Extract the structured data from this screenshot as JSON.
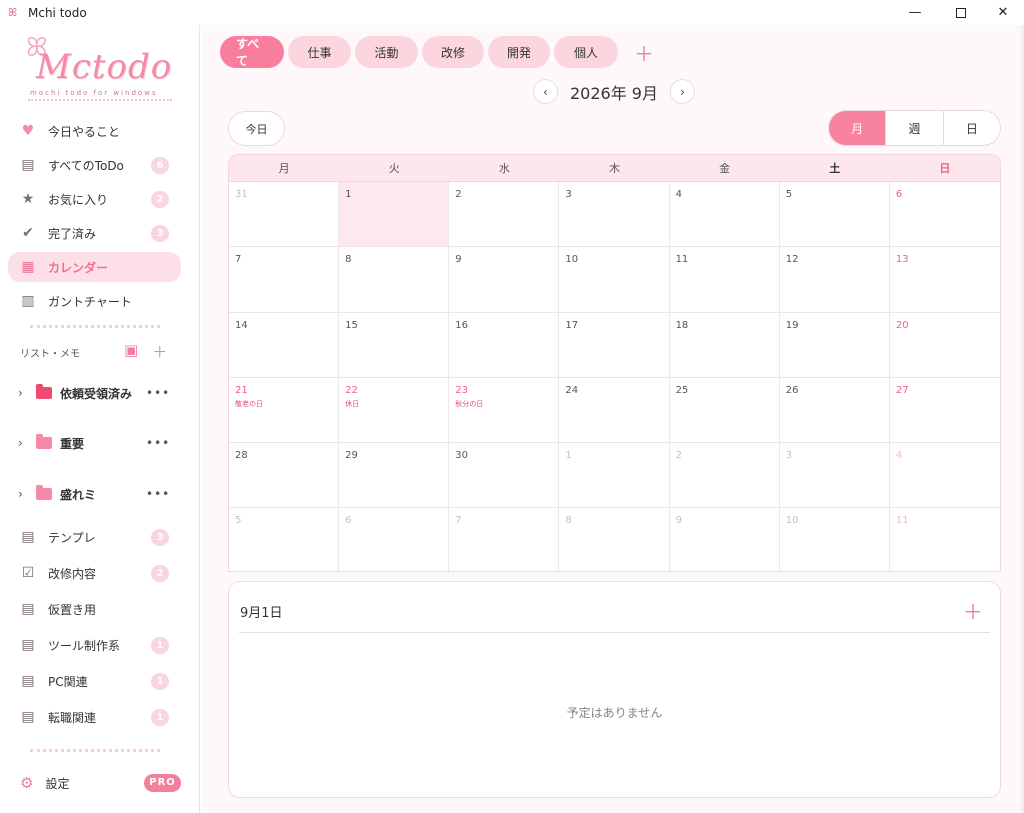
{
  "window": {
    "title": "Mchi todo",
    "icon_glyph": "ꕤ"
  },
  "logo": {
    "text": "Mctodo",
    "subtitle": "mochi todo for windows"
  },
  "sidebar": {
    "nav": [
      {
        "label": "今日やること",
        "icon": "heart-icon",
        "glyph": "♥",
        "badge": ""
      },
      {
        "label": "すべてのToDo",
        "icon": "list-icon",
        "glyph": "▤",
        "badge": "6"
      },
      {
        "label": "お気に入り",
        "icon": "star-icon",
        "glyph": "★",
        "badge": "2"
      },
      {
        "label": "完了済み",
        "icon": "check-circle-icon",
        "glyph": "✔",
        "badge": "3"
      },
      {
        "label": "カレンダー",
        "icon": "calendar-icon",
        "glyph": "▦",
        "badge": ""
      },
      {
        "label": "ガントチャート",
        "icon": "gantt-icon",
        "glyph": "▥",
        "badge": ""
      }
    ],
    "section_label": "リスト・メモ",
    "folders": [
      {
        "label": "依頼受領済み",
        "color": "#ef4a74"
      },
      {
        "label": "重要",
        "color": "#f48aa6"
      },
      {
        "label": "盛れミ",
        "color": "#f48aa6"
      }
    ],
    "lists": [
      {
        "label": "テンプレ",
        "icon": "note-icon",
        "glyph": "▤",
        "badge": "3"
      },
      {
        "label": "改修内容",
        "icon": "checklist-icon",
        "glyph": "☑",
        "badge": "2"
      },
      {
        "label": "仮置き用",
        "icon": "note-icon",
        "glyph": "▤",
        "badge": ""
      },
      {
        "label": "ツール制作系",
        "icon": "note-icon",
        "glyph": "▤",
        "badge": "1"
      },
      {
        "label": "PC関連",
        "icon": "note-icon",
        "glyph": "▤",
        "badge": "1"
      },
      {
        "label": "転職関連",
        "icon": "note-icon",
        "glyph": "▤",
        "badge": "1"
      }
    ],
    "settings_label": "設定",
    "pro_label": "PRO"
  },
  "tabs": [
    "すべて",
    "仕事",
    "活動",
    "改修",
    "開発",
    "個人"
  ],
  "month_title": "2026年 9月",
  "today_label": "今日",
  "views": [
    "月",
    "週",
    "日"
  ],
  "weekdays": [
    "月",
    "火",
    "水",
    "木",
    "金",
    "土",
    "日"
  ],
  "calendar": [
    [
      {
        "d": "31",
        "m": true
      },
      {
        "d": "1",
        "sel": true
      },
      {
        "d": "2"
      },
      {
        "d": "3"
      },
      {
        "d": "4"
      },
      {
        "d": "5"
      },
      {
        "d": "6",
        "sun": true
      }
    ],
    [
      {
        "d": "7"
      },
      {
        "d": "8"
      },
      {
        "d": "9"
      },
      {
        "d": "10"
      },
      {
        "d": "11"
      },
      {
        "d": "12"
      },
      {
        "d": "13",
        "sun": true
      }
    ],
    [
      {
        "d": "14"
      },
      {
        "d": "15"
      },
      {
        "d": "16"
      },
      {
        "d": "17"
      },
      {
        "d": "18"
      },
      {
        "d": "19"
      },
      {
        "d": "20",
        "sun": true
      }
    ],
    [
      {
        "d": "21",
        "sun": true,
        "h": "敬老の日"
      },
      {
        "d": "22",
        "sun": true,
        "h": "休日"
      },
      {
        "d": "23",
        "sun": true,
        "h": "秋分の日"
      },
      {
        "d": "24"
      },
      {
        "d": "25"
      },
      {
        "d": "26"
      },
      {
        "d": "27",
        "sun": true
      }
    ],
    [
      {
        "d": "28"
      },
      {
        "d": "29"
      },
      {
        "d": "30"
      },
      {
        "d": "1",
        "m": true
      },
      {
        "d": "2",
        "m": true
      },
      {
        "d": "3",
        "m": true
      },
      {
        "d": "4",
        "m": true,
        "sun": true
      }
    ],
    [
      {
        "d": "5",
        "m": true
      },
      {
        "d": "6",
        "m": true
      },
      {
        "d": "7",
        "m": true
      },
      {
        "d": "8",
        "m": true
      },
      {
        "d": "9",
        "m": true
      },
      {
        "d": "10",
        "m": true
      },
      {
        "d": "11",
        "m": true,
        "sun": true
      }
    ]
  ],
  "day_panel": {
    "title": "9月1日",
    "empty_text": "予定はありません"
  }
}
